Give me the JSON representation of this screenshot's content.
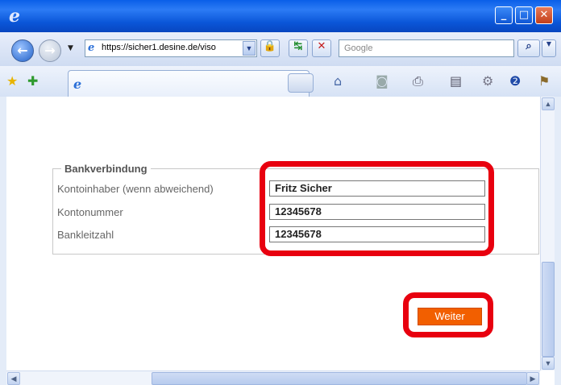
{
  "browser": {
    "address_url": "https://sicher1.desine.de/viso",
    "search_placeholder": "Google",
    "window_buttons": {
      "minimize": "_",
      "maximize": "□",
      "close": "✕"
    }
  },
  "form": {
    "legend": "Bankverbindung",
    "rows": [
      {
        "label": "Kontoinhaber (wenn abweichend)",
        "value": "Fritz Sicher"
      },
      {
        "label": "Kontonummer",
        "value": "12345678"
      },
      {
        "label": "Bankleitzahl",
        "value": "12345678"
      }
    ],
    "submit_label": "Weiter"
  },
  "colors": {
    "highlight": "#e8000f",
    "submit_button": "#f25f00",
    "titlebar": "#0a5fe8"
  },
  "icons": [
    "ie-logo-icon",
    "back-icon",
    "forward-icon",
    "lock-icon",
    "refresh-icon",
    "stop-icon",
    "search-icon",
    "star-icon",
    "add-favorite-icon",
    "home-icon",
    "rss-icon",
    "print-icon",
    "page-icon",
    "tools-icon",
    "help-icon",
    "research-icon"
  ]
}
